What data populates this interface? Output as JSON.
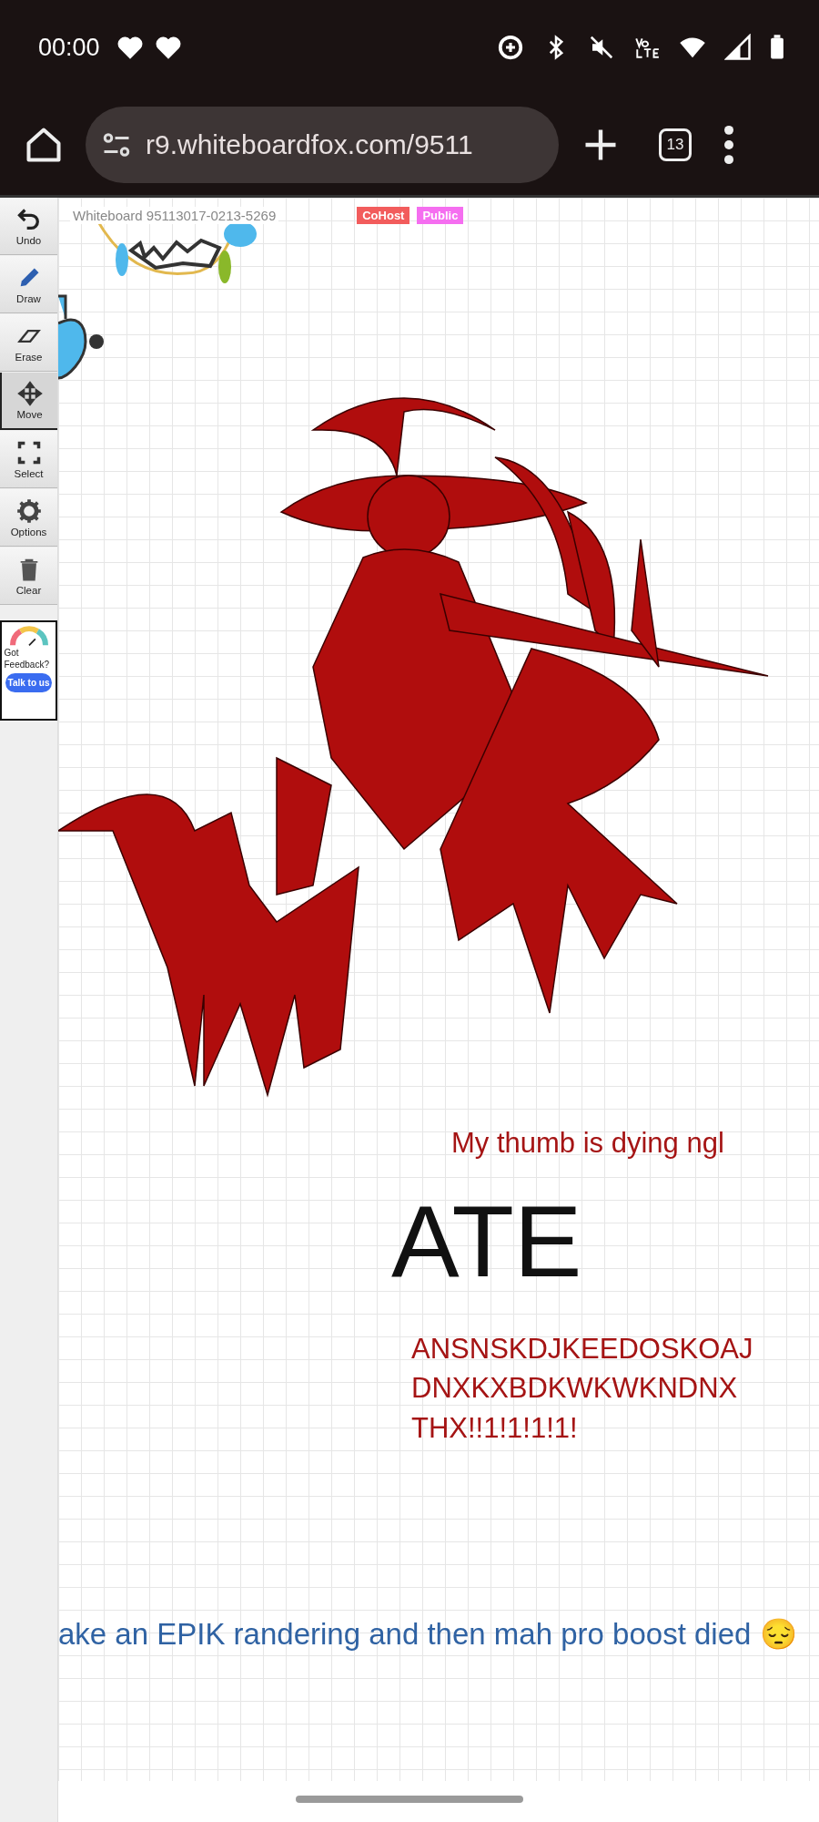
{
  "status_bar": {
    "time": "00:00"
  },
  "browser": {
    "url": "r9.whiteboardfox.com/9511",
    "tab_count": "13"
  },
  "toolbar": {
    "tools": [
      {
        "label": "Undo",
        "selected": false
      },
      {
        "label": "Draw",
        "selected": false
      },
      {
        "label": "Erase",
        "selected": false
      },
      {
        "label": "Move",
        "selected": true
      },
      {
        "label": "Select",
        "selected": false
      },
      {
        "label": "Options",
        "selected": false
      },
      {
        "label": "Clear",
        "selected": false
      }
    ]
  },
  "feedback": {
    "text": "Got Feedback?",
    "button": "Talk to us"
  },
  "whiteboard": {
    "title": "Whiteboard 95113017-0213-5269",
    "badges": [
      {
        "label": "CoHost",
        "color": "#f25c5c"
      },
      {
        "label": "Public",
        "color": "#f56ef0"
      }
    ]
  },
  "canvas_texts": [
    {
      "lines": [
        "My thumb is dying ngl"
      ],
      "color": "#a51414"
    },
    {
      "lines": [
        "ATE"
      ],
      "color": "#111111"
    },
    {
      "lines": [
        "ANSNSKDJKEEDOSKOAJ",
        "DNXKXBDKWKWKNDNX",
        "THX!!1!1!1!1!"
      ],
      "color": "#a51414"
    },
    {
      "lines": [
        "ake an EPIK randering and then mah pro boost died 😔"
      ],
      "color": "#2f62a3"
    }
  ]
}
